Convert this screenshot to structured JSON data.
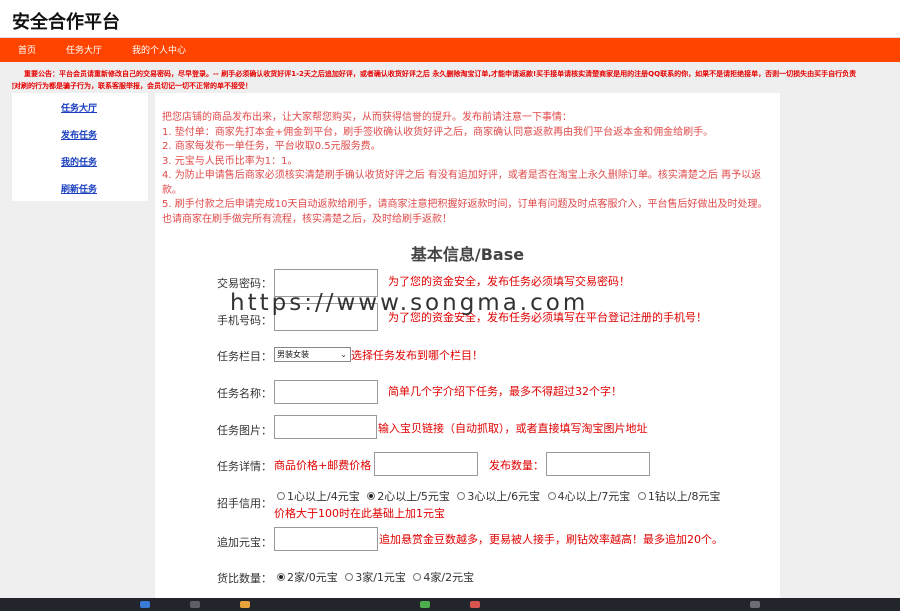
{
  "header": {
    "site_title": "安全合作平台"
  },
  "nav": {
    "items": [
      "首页",
      "任务大厅",
      "我的个人中心"
    ]
  },
  "notice": {
    "line1": "重要公告：平台会员请重新修改自己的交易密码，尽早登录。-- 刷手必须确认收货好评1-2天之后追加好评，或者确认收货好评之后 永久删除淘宝订单,才能申请返款!买手接单请核实清楚商家是用的注册QQ联系的你，如果不是请拒绝接单，否则一切损失由买手自行负责",
    "line2": "任何对刷的行为都是骗子行为，联系客服举报，会员切记一切不正常的单不接受！"
  },
  "sidebar": {
    "items": [
      "任务大厅",
      "发布任务",
      "我的任务",
      "刷新任务"
    ]
  },
  "rules": {
    "intro": "把您店铺的商品发布出来，让大家帮您购买，从而获得信誉的提升。发布前请注意一下事情：",
    "items": [
      "1. 垫付单：商家先打本金+佣金到平台，刷手签收确认收货好评之后，商家确认同意返款再由我们平台返本金和佣金给刷手。",
      "2. 商家每发布一单任务，平台收取0.5元服务费。",
      "3. 元宝与人民币比率为1：1。",
      "4. 为防止申请售后商家必须核实清楚刷手确认收货好评之后 有没有追加好评，或者是否在淘宝上永久删除订单。核实清楚之后 再予以返款。",
      "5. 刷手付款之后申请完成10天自动返款给刷手，请商家注意把积握好返款时间，订单有问题及时点客服介入，平台售后好做出及时处理。也请商家在刷手做完所有流程，核实清楚之后，及时给刷手返款！"
    ]
  },
  "form": {
    "section_title": "基本信息/Base",
    "password": {
      "label": "交易密码：",
      "hint": "为了您的资金安全，发布任务必须填写交易密码！"
    },
    "phone": {
      "label": "手机号码：",
      "hint": "为了您的资金安全，发布任务必须填写在平台登记注册的手机号！"
    },
    "column": {
      "label": "任务栏目：",
      "selected": "男装女装",
      "hint": "选择任务发布到哪个栏目！"
    },
    "name": {
      "label": "任务名称：",
      "hint": "简单几个字介绍下任务，最多不得超过32个字！"
    },
    "image": {
      "label": "任务图片：",
      "hint": "输入宝贝链接（自动抓取），或者直接填写淘宝图片地址"
    },
    "detail": {
      "label": "任务详情：",
      "price_label": "商品价格+邮费价格",
      "qty_label": "发布数量："
    },
    "credit": {
      "label": "招手信用：",
      "options": [
        "1心以上/4元宝",
        "2心以上/5元宝",
        "3心以上/6元宝",
        "4心以上/7元宝",
        "1钻以上/8元宝"
      ],
      "selected_index": 1,
      "note": "价格大于100时在此基础上加1元宝"
    },
    "bonus": {
      "label": "追加元宝：",
      "hint": "追加悬赏金豆数越多，更易被人接手，刷钻效率越高！最多追加20个。"
    },
    "compare": {
      "label": "货比数量：",
      "options": [
        "2家/0元宝",
        "3家/1元宝",
        "4家/2元宝"
      ],
      "selected_index": 0
    }
  },
  "watermark": "https://www.songma.com",
  "colors": {
    "nav_bg": "#ff4400",
    "hint_red": "#e00000",
    "link_blue": "#1a3fbf"
  }
}
